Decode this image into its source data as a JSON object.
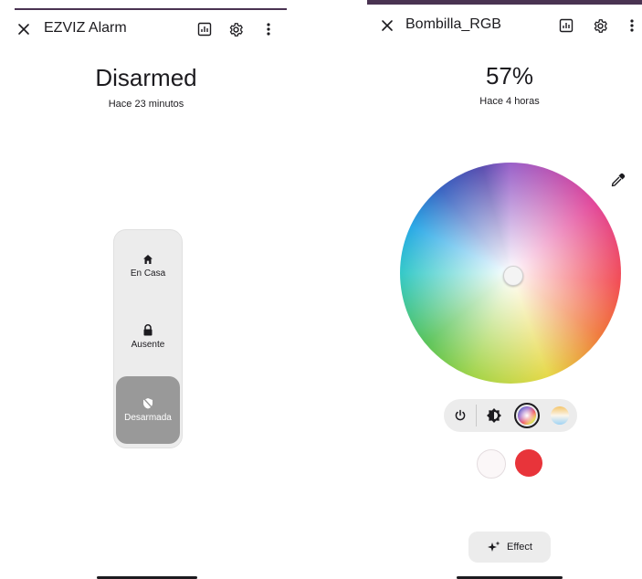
{
  "left_panel": {
    "title": "EZVIZ Alarm",
    "state": "Disarmed",
    "last_changed": "Hace 23 minutos",
    "modes": [
      {
        "label": "En Casa",
        "icon": "home-icon",
        "active": false
      },
      {
        "label": "Ausente",
        "icon": "lock-icon",
        "active": false
      },
      {
        "label": "Desarmada",
        "icon": "shield-off-icon",
        "active": true
      }
    ]
  },
  "right_panel": {
    "title": "Bombilla_RGB",
    "brightness": "57%",
    "last_changed": "Hace 4 horas",
    "effect_label": "Effect",
    "swatches": [
      "#fbf7f8",
      "#e8343a"
    ]
  },
  "colors": {
    "accent": "#4a3352",
    "active_mode": "#999999",
    "control_bg": "#ececec"
  }
}
